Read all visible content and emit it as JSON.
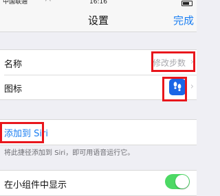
{
  "status_bar": {
    "carrier": "中国联通",
    "time": "16:16"
  },
  "nav": {
    "title": "设置",
    "done_label": "完成"
  },
  "rows": {
    "name": {
      "label": "名称",
      "value": "修改步数"
    },
    "icon": {
      "label": "图标",
      "icon_name": "footprints-icon",
      "tile_color": "#1b66e6"
    }
  },
  "siri": {
    "add_label": "添加到 Siri",
    "hint": "将此捷径添加到 Siri，即可用语音运行它。"
  },
  "widget": {
    "label": "在小组件中显示",
    "enabled": true
  },
  "colors": {
    "accent": "#1a7ef2",
    "highlight": "#e8161c",
    "toggle_on": "#4cd964"
  }
}
